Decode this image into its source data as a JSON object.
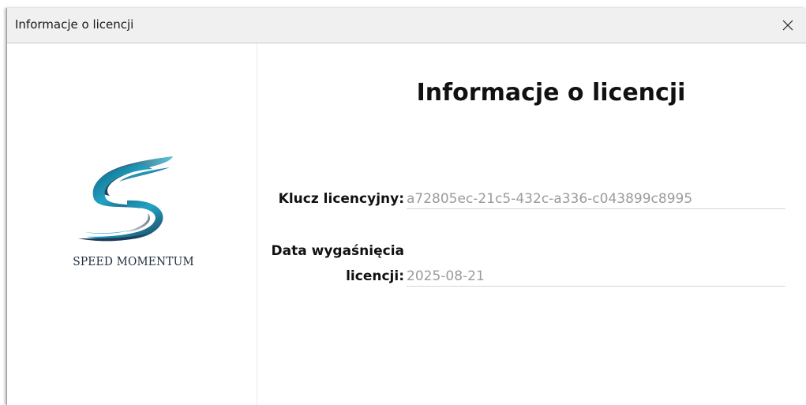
{
  "window": {
    "title": "Informacje o licencji",
    "close_icon": "close-icon"
  },
  "logo": {
    "icon": "speed-momentum-logo",
    "text": "SPEED MOMENTUM",
    "colors": [
      "#0e7fa0",
      "#1e3b57",
      "#4fb7cf"
    ]
  },
  "content": {
    "heading": "Informacje o licencji",
    "license_key_label": "Klucz licencyjny:",
    "license_key_value": "a72805ec-21c5-432c-a336-c043899c8995",
    "expiry_label_line1": "Data wygaśnięcia",
    "expiry_label_line2": "licencji:",
    "expiry_value": "2025-08-21"
  }
}
